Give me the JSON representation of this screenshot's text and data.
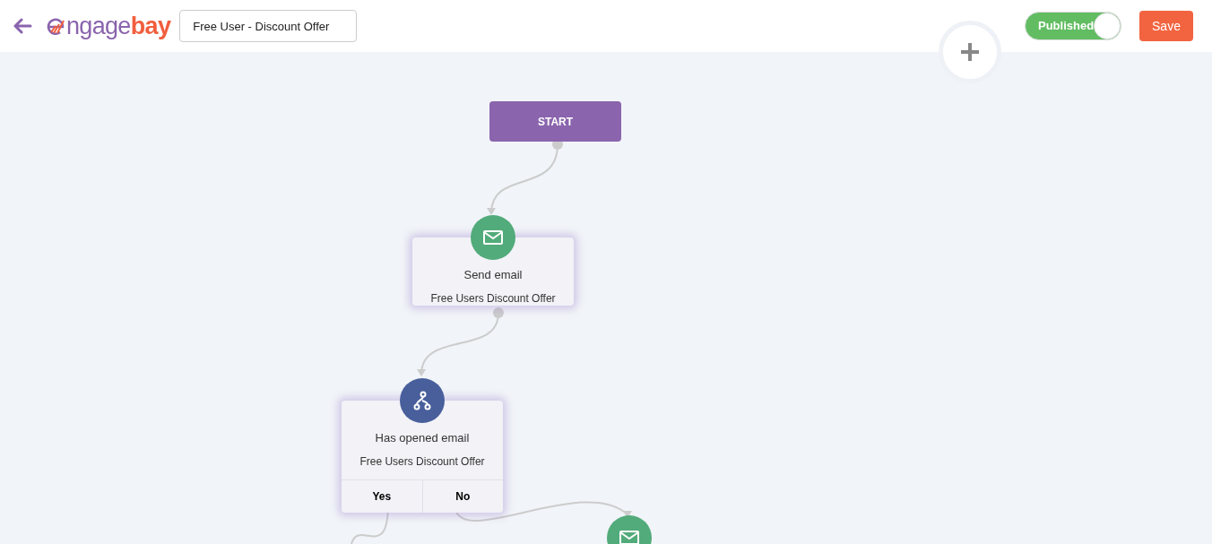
{
  "header": {
    "logo": {
      "text_start": "ngage",
      "text_end": "bay"
    },
    "workflow_name": "Free User - Discount Offer",
    "status_toggle": {
      "label": "Published",
      "on": true
    },
    "save_button": "Save"
  },
  "canvas": {
    "nodes": [
      {
        "kind": "start",
        "label": "START"
      },
      {
        "kind": "email",
        "title": "Send email",
        "subtitle": "Free Users Discount Offer"
      },
      {
        "kind": "condition",
        "title": "Has opened email",
        "subtitle": "Free Users Discount Offer",
        "branches": [
          "Yes",
          "No"
        ]
      },
      {
        "kind": "email_partial"
      }
    ]
  }
}
